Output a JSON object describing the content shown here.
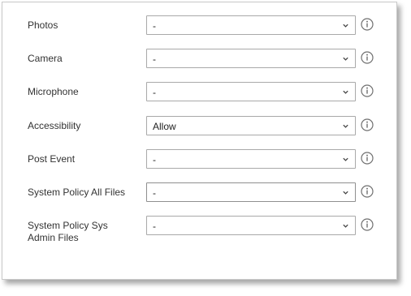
{
  "settings": [
    {
      "label": "Photos",
      "value": "-"
    },
    {
      "label": "Camera",
      "value": "-"
    },
    {
      "label": "Microphone",
      "value": "-"
    },
    {
      "label": "Accessibility",
      "value": "Allow"
    },
    {
      "label": "Post Event",
      "value": "-"
    },
    {
      "label": "System Policy All Files",
      "value": "-"
    },
    {
      "label": "System Policy Sys Admin Files",
      "value": "-"
    }
  ],
  "icons": {
    "dropdown": "chevron-down-icon",
    "info": "info-icon"
  },
  "colors": {
    "label_text": "#333333",
    "border": "#a9a9a9",
    "icon": "#707070"
  }
}
